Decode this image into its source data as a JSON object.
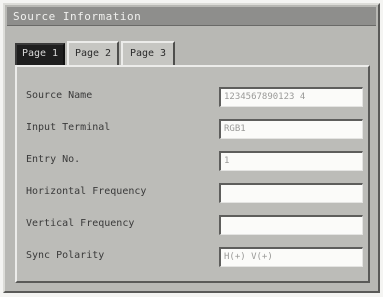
{
  "window": {
    "title": "Source Information"
  },
  "tabs": [
    {
      "label": "Page 1",
      "active": true
    },
    {
      "label": "Page 2",
      "active": false
    },
    {
      "label": "Page 3",
      "active": false
    }
  ],
  "fields": [
    {
      "label": "Source Name",
      "value": "1234567890123 4"
    },
    {
      "label": "Input Terminal",
      "value": "RGB1"
    },
    {
      "label": "Entry No.",
      "value": "1"
    },
    {
      "label": "Horizontal Frequency",
      "value": ""
    },
    {
      "label": "Vertical Frequency",
      "value": ""
    },
    {
      "label": "Sync Polarity",
      "value": "H(+) V(+)"
    }
  ]
}
